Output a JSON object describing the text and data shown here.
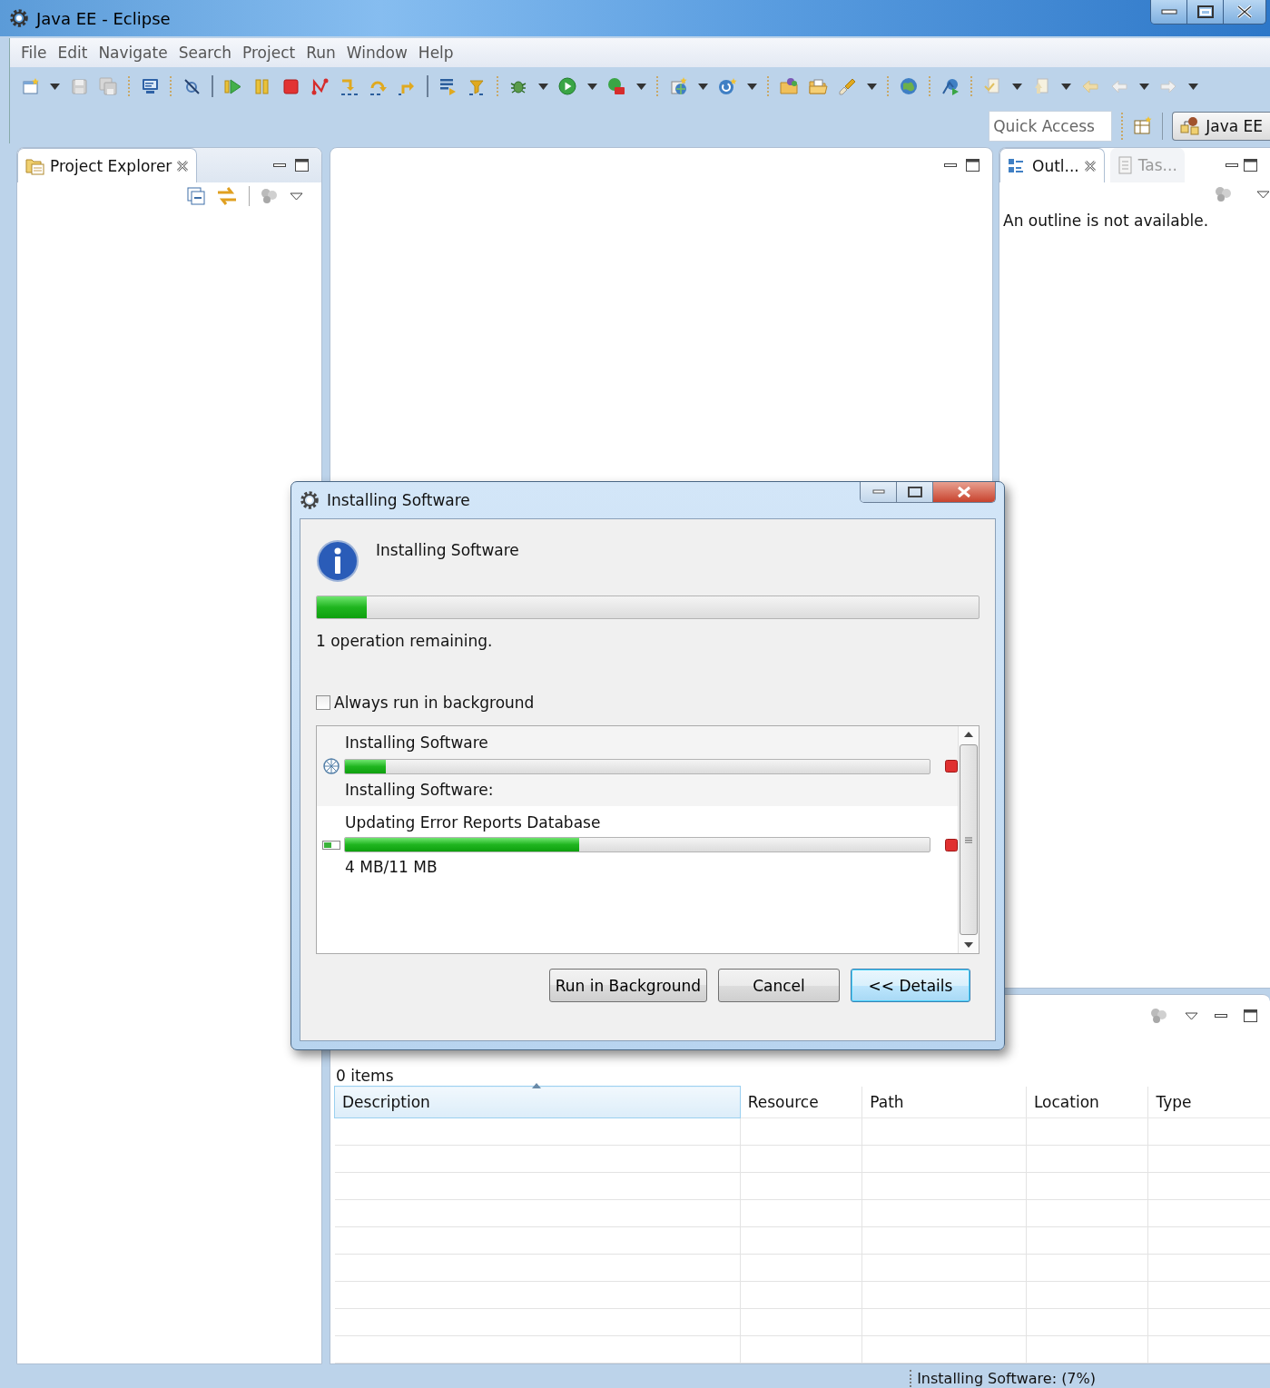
{
  "window": {
    "title": "Java EE - Eclipse"
  },
  "menu": [
    {
      "label": "File"
    },
    {
      "label": "Edit"
    },
    {
      "label": "Navigate"
    },
    {
      "label": "Search"
    },
    {
      "label": "Project"
    },
    {
      "label": "Run"
    },
    {
      "label": "Window"
    },
    {
      "label": "Help"
    }
  ],
  "quick_access": {
    "placeholder": "Quick Access"
  },
  "perspective": {
    "label": "Java EE",
    "selected": true
  },
  "project_explorer": {
    "tab": "Project Explorer"
  },
  "outline": {
    "tabs": [
      {
        "label": "Outl...",
        "selected": true
      },
      {
        "label": "Tas...",
        "selected": false
      }
    ],
    "message": "An outline is not available."
  },
  "problems": {
    "count": "0 items",
    "columns": [
      {
        "label": "Description",
        "sorted": true
      },
      {
        "label": "Resource",
        "sorted": false
      },
      {
        "label": "Path",
        "sorted": false
      },
      {
        "label": "Location",
        "sorted": false
      },
      {
        "label": "Type",
        "sorted": false
      }
    ]
  },
  "status_bar": {
    "text": "Installing Software: (7%)"
  },
  "dialog": {
    "title": "Installing Software",
    "heading": "Installing Software",
    "level": 0.075,
    "message": "1 operation remaining.",
    "checkbox": {
      "label": "Always run in background",
      "checked": false
    },
    "jobs": [
      {
        "name": "Installing Software",
        "level": 0.07,
        "status": "Installing Software:"
      },
      {
        "name": "Updating Error Reports Database",
        "level": 0.4,
        "status": "4 MB/11 MB"
      }
    ],
    "buttons": [
      {
        "label": "Run in Background",
        "default": false
      },
      {
        "label": "Cancel",
        "default": false
      },
      {
        "label": "<< Details",
        "default": true
      }
    ]
  }
}
